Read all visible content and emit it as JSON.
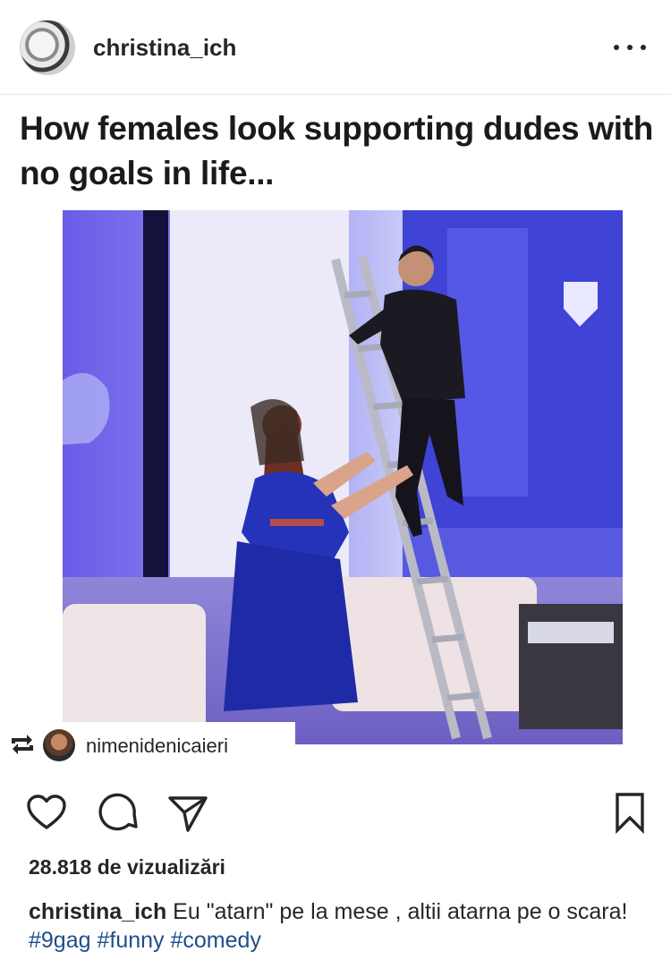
{
  "post": {
    "username": "christina_ich",
    "more_icon": "more-horizontal-icon",
    "meme_caption": "How females look supporting dudes with no goals in life...",
    "repost": {
      "icon": "repost-icon",
      "username": "nimenidenicaieri"
    }
  },
  "actions": {
    "like_icon": "heart-icon",
    "comment_icon": "comment-icon",
    "share_icon": "send-icon",
    "save_icon": "bookmark-icon"
  },
  "stats": {
    "views": "28.818 de vizualizări"
  },
  "caption": {
    "username": "christina_ich",
    "text": " Eu \"atarn\" pe la mese , altii atarna pe o scara! ",
    "hashtags": [
      "#9gag",
      "#funny",
      "#comedy"
    ]
  },
  "colors": {
    "hashtag": "#1e4f89",
    "text": "#262626",
    "divider": "#e6e6e6"
  }
}
